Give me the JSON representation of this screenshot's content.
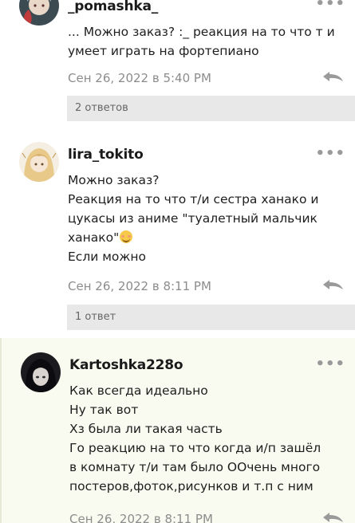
{
  "comments": [
    {
      "username": "_pomashka_",
      "lines": [
        "... Можно заказ? :_ реакция на то что т и",
        "умеет играть на фортепиано"
      ],
      "date": "Сен 26, 2022 в 5:40 PM",
      "replies": "2 ответов"
    },
    {
      "username": "lira_tokito",
      "lines": [
        "Можно заказ?",
        "Реакция на то что т/и сестра ханако и",
        "цукасы из аниме \"туалетный мальчик",
        "ханако\"",
        "Если можно"
      ],
      "date": "Сен 26, 2022 в 8:11 PM",
      "replies": "1 ответ"
    },
    {
      "username": "Kartoshka228o",
      "lines": [
        "Как всегда идеально",
        "Ну так вот",
        "Хз была ли такая часть",
        "Го реакцию на то что когда и/п зашёл",
        "в комнату т/и там было ООчень много",
        "постеров,фоток,рисунков и т.п с ним"
      ],
      "date": "Сен 26, 2022 в 8:11 PM"
    }
  ],
  "icons": {
    "more": "more-dots-icon",
    "reply": "reply-arrow-icon",
    "emoji": "smiling-face-icon"
  },
  "colors": {
    "muted": "#8c8c8c",
    "reply_bar": "#e8e8e8",
    "highlight_bg": "#fafbf0"
  }
}
